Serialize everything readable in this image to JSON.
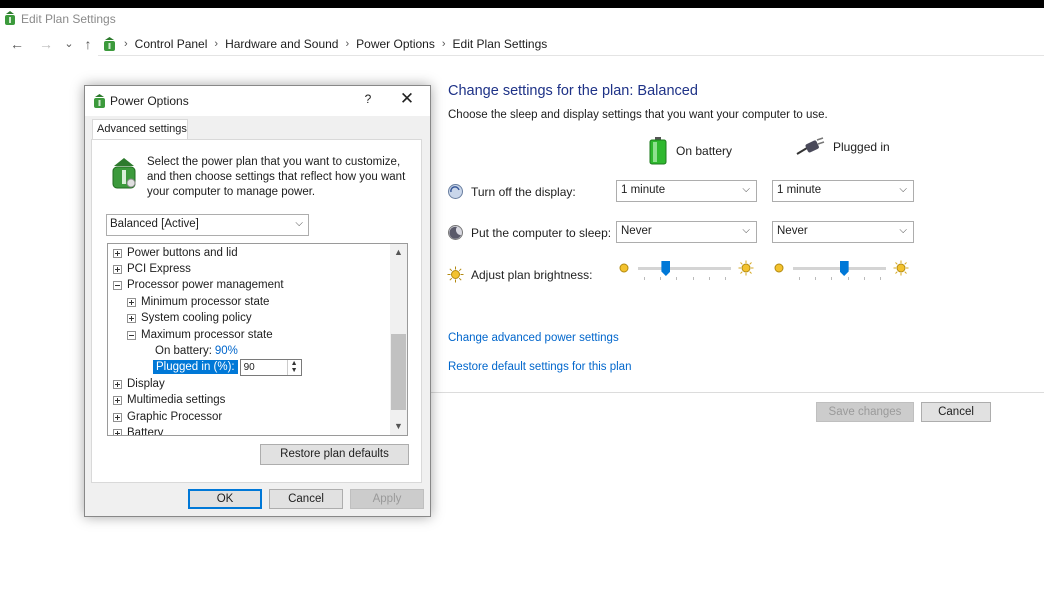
{
  "window": {
    "title": "Edit Plan Settings"
  },
  "nav": {
    "back": "←",
    "forward": "→",
    "recent": "⌄",
    "up": "↑",
    "breadcrumbs": [
      "Control Panel",
      "Hardware and Sound",
      "Power Options",
      "Edit Plan Settings"
    ],
    "sep": "›"
  },
  "main": {
    "title": "Change settings for the plan: Balanced",
    "subtitle": "Choose the sleep and display settings that you want your computer to use.",
    "columns": {
      "battery": "On battery",
      "plugged": "Plugged in"
    },
    "rows": [
      {
        "label": "Turn off the display:",
        "battery": "1 minute",
        "plugged": "1 minute"
      },
      {
        "label": "Put the computer to sleep:",
        "battery": "Never",
        "plugged": "Never"
      }
    ],
    "brightness": {
      "label": "Adjust plan brightness:",
      "battery_level": 0.3,
      "plugged_level": 0.55
    },
    "links": {
      "advanced": "Change advanced power settings",
      "restore": "Restore default settings for this plan"
    },
    "buttons": {
      "save": "Save changes",
      "cancel": "Cancel"
    }
  },
  "dialog": {
    "title": "Power Options",
    "help": "?",
    "close": "✕",
    "tab": "Advanced settings",
    "intro": "Select the power plan that you want to customize, and then choose settings that reflect how you want your computer to manage power.",
    "plan": "Balanced [Active]",
    "tree": {
      "power_buttons": "Power buttons and lid",
      "pci": "PCI Express",
      "ppm": "Processor power management",
      "min_state": "Minimum processor state",
      "cooling": "System cooling policy",
      "max_state": "Maximum processor state",
      "on_battery_label": "On battery:",
      "on_battery_value": "90%",
      "plugged_label": "Plugged in (%):",
      "plugged_value": "90",
      "display": "Display",
      "multimedia": "Multimedia settings",
      "graphic": "Graphic Processor",
      "battery": "Battery"
    },
    "restore": "Restore plan defaults",
    "ok": "OK",
    "cancel": "Cancel",
    "apply": "Apply"
  }
}
